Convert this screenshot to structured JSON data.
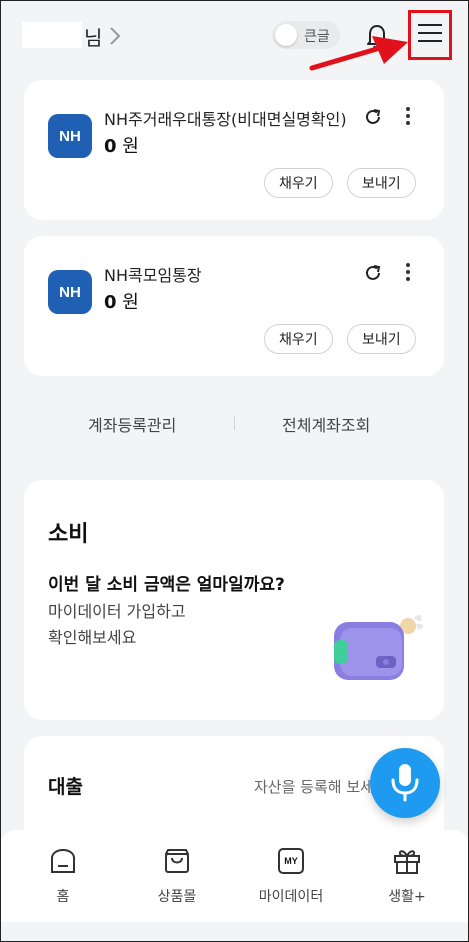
{
  "header": {
    "user_suffix": "님",
    "text_size_label": "큰글"
  },
  "accounts": [
    {
      "name": "NH주거래우대통장(비대면실명확인)",
      "balance_amount": "0",
      "balance_unit": "원",
      "bank_logo_text": "NH",
      "fill_label": "채우기",
      "send_label": "보내기"
    },
    {
      "name": "NH콕모임통장",
      "balance_amount": "0",
      "balance_unit": "원",
      "bank_logo_text": "NH",
      "fill_label": "채우기",
      "send_label": "보내기"
    }
  ],
  "account_links": {
    "manage": "계좌등록관리",
    "all": "전체계좌조회"
  },
  "spending": {
    "title": "소비",
    "question": "이번 달 소비 금액은 얼마일까요?",
    "desc_line1": "마이데이터 가입하고",
    "desc_line2": "확인해보세요"
  },
  "loan": {
    "title": "대출",
    "desc": "자산을 등록해 보세요"
  },
  "bottom_nav": [
    {
      "label": "홈",
      "icon": "home-icon"
    },
    {
      "label": "상품몰",
      "icon": "shopping-bag-icon"
    },
    {
      "label": "마이데이터",
      "icon": "mydata-icon",
      "badge": "MY"
    },
    {
      "label": "생활+",
      "icon": "gift-icon"
    }
  ],
  "colors": {
    "nh_blue": "#1f5fb4",
    "mic_blue": "#1e9bf0",
    "highlight_red": "#e0111b",
    "background": "#f3f4f6"
  }
}
